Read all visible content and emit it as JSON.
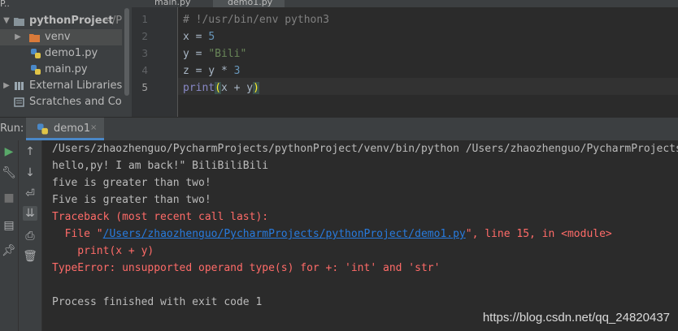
{
  "project_panel": {
    "header": "P..",
    "items": [
      {
        "label": "pythonProject",
        "suffix": "~/P",
        "type": "folder-root",
        "expanded": true
      },
      {
        "label": "venv",
        "type": "folder",
        "expanded": false
      },
      {
        "label": "demo1.py",
        "type": "python-file"
      },
      {
        "label": "main.py",
        "type": "python-file"
      },
      {
        "label": "External Libraries",
        "type": "library",
        "expanded": false
      },
      {
        "label": "Scratches and Cons",
        "type": "scratches"
      }
    ]
  },
  "editor_tabs": [
    {
      "label": "main.py",
      "active": false
    },
    {
      "label": "demo1.py",
      "active": true
    }
  ],
  "editor": {
    "line_numbers": [
      "1",
      "2",
      "3",
      "4",
      "5"
    ],
    "lines": {
      "l1": "# !/usr/bin/env python3",
      "l2_var": "x",
      "l2_op": " = ",
      "l2_val": "5",
      "l3_var": "y",
      "l3_op": " = ",
      "l3_val": "\"Bili\"",
      "l4_var": "z",
      "l4_op": " = y * ",
      "l4_val": "3",
      "l5_fn": "print",
      "l5_open": "(",
      "l5_mid": "x + y",
      "l5_close": ")"
    }
  },
  "run_panel": {
    "label": "Run:",
    "tab_label": "demo1",
    "close": "×"
  },
  "console": {
    "lines": [
      "/Users/zhaozhenguo/PycharmProjects/pythonProject/venv/bin/python /Users/zhaozhenguo/PycharmProjects",
      "hello,py! I am back!\" BiliBiliBili",
      "five is greater than two!",
      "Five is greater than two!",
      "Traceback (most recent call last):"
    ],
    "file_prefix": "  File \"",
    "file_link": "/Users/zhaozhenguo/PycharmProjects/pythonProject/demo1.py",
    "file_suffix": "\", line 15, in <module>",
    "code_line": "    print(x + y)",
    "error_line": "TypeError: unsupported operand type(s) for +: 'int' and 'str'",
    "exit_line": "Process finished with exit code 1"
  },
  "watermark": "https://blog.csdn.net/qq_24820437",
  "colors": {
    "editor_bg": "#2b2b2b",
    "panel_bg": "#3c3f41",
    "error_red": "#ff6b68",
    "link_blue": "#287bde",
    "run_green": "#59a869"
  }
}
